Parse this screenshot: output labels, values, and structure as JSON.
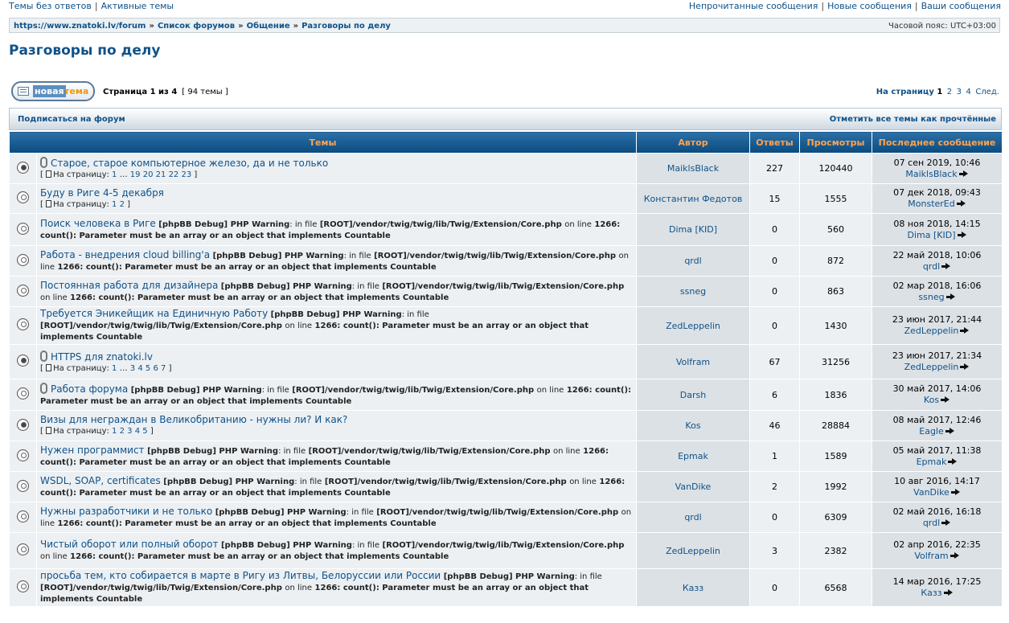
{
  "top_links": {
    "left": [
      "Темы без ответов",
      "Активные темы"
    ],
    "right": [
      "Непрочитанные сообщения",
      "Новые сообщения",
      "Ваши сообщения"
    ],
    "separator": "|"
  },
  "breadcrumb": {
    "items": [
      "https://www.znatoki.lv/forum",
      "Список форумов",
      "Общение",
      "Разговоры по делу"
    ],
    "arrow": "»",
    "timezone": "Часовой пояс: UTC+03:00"
  },
  "page_title": "Разговоры по делу",
  "new_topic_button": {
    "word1": "новая",
    "word2": "тема"
  },
  "page_info": {
    "label": "Страница 1 из 4",
    "count": "[ 94 темы ]"
  },
  "pagination": {
    "label": "На страницу",
    "current": "1",
    "pages": [
      "2",
      "3",
      "4"
    ],
    "next": "След."
  },
  "subscribe_bar": {
    "subscribe": "Подписаться на форум",
    "mark_read": "Отметить все темы как прочтённые"
  },
  "table": {
    "headers": {
      "topics": "Темы",
      "author": "Автор",
      "replies": "Ответы",
      "views": "Просмотры",
      "last": "Последнее сообщение"
    },
    "on_page_label": "На страницу:",
    "debug": {
      "tag": "[phpBB Debug] PHP Warning",
      "in_file": ": in file",
      "path": "[ROOT]/vendor/twig/twig/lib/Twig/Extension/Core.php",
      "on_line": "on line",
      "line": "1266",
      "message": ": count(): Parameter must be an array or an object that implements Countable"
    },
    "rows": [
      {
        "title": "Старое, старое компьютерное железо, да и не только",
        "attach": true,
        "hot": true,
        "debug": false,
        "pages": [
          "1",
          "…",
          "19",
          "20",
          "21",
          "22",
          "23"
        ],
        "author": "MaiklsBlack",
        "replies": "227",
        "views": "120440",
        "last_date": "07 сен 2019, 10:46",
        "last_by": "MaiklsBlack"
      },
      {
        "title": "Буду в Риге 4-5 декабря",
        "attach": false,
        "hot": false,
        "debug": false,
        "pages": [
          "1",
          "2"
        ],
        "author": "Константин Федотов",
        "replies": "15",
        "views": "1555",
        "last_date": "07 дек 2018, 09:43",
        "last_by": "MonsterEd"
      },
      {
        "title": "Поиск человека в Риге",
        "attach": false,
        "hot": false,
        "debug": true,
        "pages": [],
        "author": "Dima [KID]",
        "replies": "0",
        "views": "560",
        "last_date": "08 ноя 2018, 14:15",
        "last_by": "Dima [KID]"
      },
      {
        "title": "Работа - внедрения cloud billing'а",
        "attach": false,
        "hot": false,
        "debug": true,
        "pages": [],
        "author": "qrdl",
        "replies": "0",
        "views": "872",
        "last_date": "22 май 2018, 10:06",
        "last_by": "qrdl"
      },
      {
        "title": "Постоянная работа для дизайнера",
        "attach": false,
        "hot": false,
        "debug": true,
        "pages": [],
        "author": "ssneg",
        "replies": "0",
        "views": "863",
        "last_date": "02 мар 2018, 16:06",
        "last_by": "ssneg"
      },
      {
        "title": "Требуется Эникейщик на Единичную Работу",
        "attach": false,
        "hot": false,
        "debug": true,
        "pages": [],
        "author": "ZedLeppelin",
        "replies": "0",
        "views": "1430",
        "last_date": "23 июн 2017, 21:44",
        "last_by": "ZedLeppelin"
      },
      {
        "title": "HTTPS для znatoki.lv",
        "attach": true,
        "hot": true,
        "debug": false,
        "pages": [
          "1",
          "…",
          "3",
          "4",
          "5",
          "6",
          "7"
        ],
        "author": "Volfram",
        "replies": "67",
        "views": "31256",
        "last_date": "23 июн 2017, 21:34",
        "last_by": "ZedLeppelin"
      },
      {
        "title": "Работа форума",
        "attach": true,
        "hot": false,
        "debug": true,
        "pages": [],
        "author": "Darsh",
        "replies": "6",
        "views": "1836",
        "last_date": "30 май 2017, 14:06",
        "last_by": "Kos"
      },
      {
        "title": "Визы для неграждан в Великобританию - нужны ли? И как?",
        "attach": false,
        "hot": true,
        "debug": false,
        "pages": [
          "1",
          "2",
          "3",
          "4",
          "5"
        ],
        "author": "Kos",
        "replies": "46",
        "views": "28884",
        "last_date": "08 май 2017, 12:46",
        "last_by": "Eagle"
      },
      {
        "title": "Нужен программист",
        "attach": false,
        "hot": false,
        "debug": true,
        "pages": [],
        "author": "Epmak",
        "replies": "1",
        "views": "1589",
        "last_date": "05 май 2017, 11:38",
        "last_by": "Epmak"
      },
      {
        "title": "WSDL, SOAP, certificates",
        "attach": false,
        "hot": false,
        "debug": true,
        "pages": [],
        "author": "VanDike",
        "replies": "2",
        "views": "1992",
        "last_date": "10 авг 2016, 14:17",
        "last_by": "VanDike"
      },
      {
        "title": "Нужны разработчики и не только",
        "attach": false,
        "hot": false,
        "debug": true,
        "pages": [],
        "author": "qrdl",
        "replies": "0",
        "views": "6309",
        "last_date": "02 май 2016, 16:18",
        "last_by": "qrdl"
      },
      {
        "title": "Чистый оборот или полный оборот",
        "attach": false,
        "hot": false,
        "debug": true,
        "pages": [],
        "author": "ZedLeppelin",
        "replies": "3",
        "views": "2382",
        "last_date": "02 апр 2016, 22:35",
        "last_by": "Volfram"
      },
      {
        "title": "просьба тем, кто собирается в марте в Ригу из Литвы, Белоруссии или России",
        "attach": false,
        "hot": false,
        "debug": true,
        "pages": [],
        "author": "Казз",
        "replies": "0",
        "views": "6568",
        "last_date": "14 мар 2016, 17:25",
        "last_by": "Казз"
      }
    ]
  }
}
